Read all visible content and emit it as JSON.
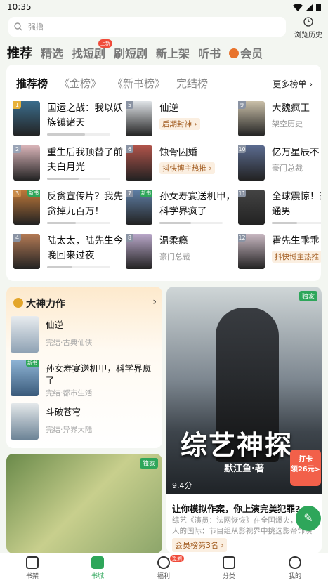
{
  "status": {
    "time": "10:35"
  },
  "search": {
    "placeholder": "强撸",
    "history": "浏览历史"
  },
  "tabs": [
    {
      "label": "推荐"
    },
    {
      "label": "精选"
    },
    {
      "label": "找短剧",
      "badge": "上新"
    },
    {
      "label": "刷短剧"
    },
    {
      "label": "新上架"
    },
    {
      "label": "听书"
    },
    {
      "label": "会员"
    }
  ],
  "ranking": {
    "tabs": [
      "推荐榜",
      "《金榜》",
      "《新书榜》",
      "完结榜"
    ],
    "more": "更多榜单 ›",
    "items": [
      {
        "num": "1",
        "title": "国运之战：我以妖族镇诸天",
        "meta": "",
        "type": "bar",
        "progress": 0.6
      },
      {
        "num": "2",
        "title": "重生后我顶替了前夫白月光",
        "meta": "",
        "type": "bar",
        "progress": 0.5
      },
      {
        "num": "3",
        "title": "反贪宣传片？我先贪掉九百万！",
        "meta": "",
        "type": "bar",
        "progress": 0.45,
        "tag": "新书"
      },
      {
        "num": "4",
        "title": "陆太太，陆先生今晚回来过夜",
        "meta": "",
        "type": "bar",
        "progress": 0.4
      },
      {
        "num": "5",
        "title": "仙逆",
        "meta": "后期封神 ›",
        "type": "pill"
      },
      {
        "num": "6",
        "title": "蚀骨囚婚",
        "meta": "抖快博主热推 ›",
        "type": "pill"
      },
      {
        "num": "7",
        "title": "孙女寿宴送机甲，科学界疯了",
        "meta": "",
        "type": "bar",
        "progress": 0.5,
        "tag": "新书"
      },
      {
        "num": "8",
        "title": "温柔瘾",
        "meta": "豪门总裁",
        "type": "sub"
      },
      {
        "num": "9",
        "title": "大魏疯王",
        "meta": "架空历史",
        "type": "sub"
      },
      {
        "num": "10",
        "title": "亿万星辰不",
        "meta": "豪门总裁",
        "type": "sub"
      },
      {
        "num": "11",
        "title": "全球震惊！这叫普通男",
        "meta": "",
        "type": "bar",
        "progress": 0.4
      },
      {
        "num": "12",
        "title": "霍先生乖乖",
        "meta": "抖快博主热推",
        "type": "pill"
      }
    ]
  },
  "god": {
    "title": "大神力作",
    "items": [
      {
        "title": "仙逆",
        "meta": "完结·古典仙侠"
      },
      {
        "title": "孙女寿宴送机甲，科学界疯了",
        "meta": "完结·都市生活",
        "tag": "新书"
      },
      {
        "title": "斗破苍穹",
        "meta": "完结·异界大陆"
      }
    ]
  },
  "banner2": {
    "tag": "独家"
  },
  "promo": {
    "tag": "独家",
    "title": "综艺神探",
    "author": "默江鱼·著",
    "score": "9.4分",
    "question": "让你模拟作案，你上演完美犯罪?",
    "desc": "综艺《演员：法网恢恢》在全国爆火，吸引人的国际：节目组从影视界中挑选影帝饰演罪犯",
    "rank": "会员榜第3名 ›"
  },
  "checkin": {
    "line1": "打卡",
    "line2": "领26元>"
  },
  "nav": [
    {
      "label": "书架"
    },
    {
      "label": "书城"
    },
    {
      "label": "福利",
      "badge": "签到"
    },
    {
      "label": "分类"
    },
    {
      "label": "我的"
    }
  ]
}
